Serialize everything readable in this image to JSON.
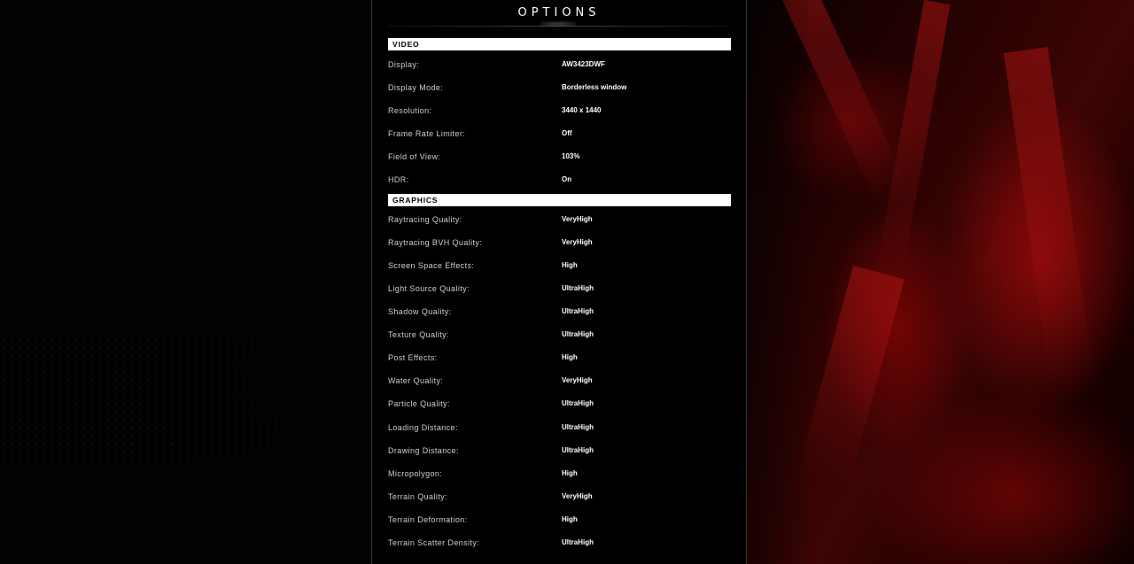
{
  "window": {
    "title": "OPTIONS"
  },
  "sections": {
    "video": {
      "label": "VIDEO",
      "rows": [
        {
          "label": "Display:",
          "value": "AW3423DWF"
        },
        {
          "label": "Display Mode:",
          "value": "Borderless window"
        },
        {
          "label": "Resolution:",
          "value": "3440 x 1440"
        },
        {
          "label": "Frame Rate Limiter:",
          "value": "Off"
        },
        {
          "label": "Field of View:",
          "value": "103%"
        },
        {
          "label": "HDR:",
          "value": "On"
        }
      ]
    },
    "graphics": {
      "label": "GRAPHICS",
      "rows": [
        {
          "label": "Raytracing Quality:",
          "value": "VeryHigh"
        },
        {
          "label": "Raytracing BVH Quality:",
          "value": "VeryHigh"
        },
        {
          "label": "Screen Space Effects:",
          "value": "High"
        },
        {
          "label": "Light Source Quality:",
          "value": "UltraHigh"
        },
        {
          "label": "Shadow Quality:",
          "value": "UltraHigh"
        },
        {
          "label": "Texture Quality:",
          "value": "UltraHigh"
        },
        {
          "label": "Post Effects:",
          "value": "High"
        },
        {
          "label": "Water Quality:",
          "value": "VeryHigh"
        },
        {
          "label": "Particle Quality:",
          "value": "UltraHigh"
        },
        {
          "label": "Loading Distance:",
          "value": "UltraHigh"
        },
        {
          "label": "Drawing Distance:",
          "value": "UltraHigh"
        },
        {
          "label": "Micropolygon:",
          "value": "High"
        },
        {
          "label": "Terrain Quality:",
          "value": "VeryHigh"
        },
        {
          "label": "Terrain Deformation:",
          "value": "High"
        },
        {
          "label": "Terrain Scatter Density:",
          "value": "UltraHigh"
        }
      ]
    }
  },
  "colors": {
    "panel_bg": "#000000",
    "section_bg": "#ffffff",
    "label_text": "#cfcfcf",
    "value_text": "#ffffff",
    "accent_red": "#8a0a0a"
  }
}
